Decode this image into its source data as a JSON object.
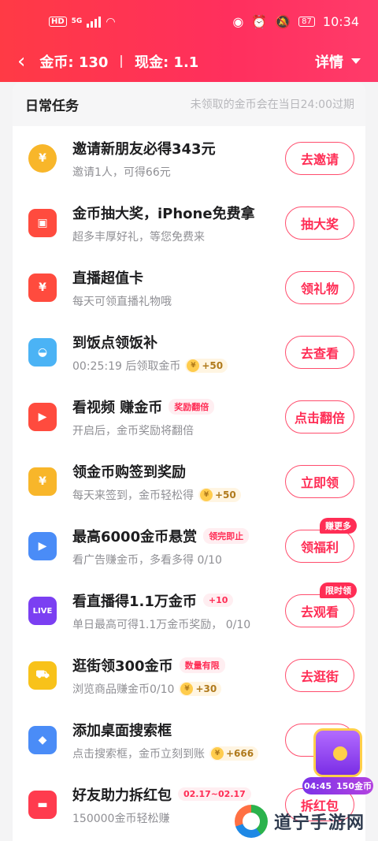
{
  "status_bar": {
    "hd": "HD",
    "network": "5G",
    "battery": "87",
    "time": "10:34"
  },
  "header": {
    "coins": "金币: 130",
    "cash": "现金: 1.1",
    "detail": "详情"
  },
  "card": {
    "title": "日常任务",
    "note": "未领取的金币会在当日24:00过期"
  },
  "tasks": [
    {
      "icon": "gold-coin-icon",
      "color": "#f8b62a",
      "title": "邀请新朋友必得343元",
      "tag": "",
      "sub": "邀请1人，可得66元",
      "reward": "",
      "button": "去邀请",
      "badge": ""
    },
    {
      "icon": "gift-box-icon",
      "color": "#ff4b3e",
      "title": "金币抽大奖，iPhone免费拿",
      "tag": "",
      "sub": "超多丰厚好礼，等您免费来",
      "reward": "",
      "button": "抽大奖",
      "badge": ""
    },
    {
      "icon": "live-gift-card-icon",
      "color": "#ff4b3e",
      "title": "直播超值卡",
      "tag": "",
      "sub": "每天可领直播礼物哦",
      "reward": "",
      "button": "领礼物",
      "badge": ""
    },
    {
      "icon": "rice-bowl-icon",
      "color": "#4bb3f5",
      "title": "到饭点领饭补",
      "tag": "",
      "sub": "00:25:19 后领取金币",
      "reward": "+50",
      "button": "去查看",
      "badge": ""
    },
    {
      "icon": "video-play-icon",
      "color": "#ff4b3e",
      "title": "看视频 赚金币",
      "tag": "奖励翻倍",
      "sub": "开启后，金币奖励将翻倍",
      "reward": "",
      "button": "点击翻倍",
      "badge": ""
    },
    {
      "icon": "money-bag-icon",
      "color": "#f8b62a",
      "title": "领金币购签到奖励",
      "tag": "",
      "sub": "每天来签到，金币轻松得",
      "reward": "+50",
      "button": "立即领",
      "badge": ""
    },
    {
      "icon": "ad-video-icon",
      "color": "#4a8cf7",
      "title": "最高6000金币悬赏",
      "tag": "领完即止",
      "sub": "看广告赚金币，多看多得 0/10",
      "reward": "",
      "button": "领福利",
      "badge": "赚更多"
    },
    {
      "icon": "live-tv-icon",
      "color": "#7b3ff2",
      "title": "看直播得1.1万金币",
      "tag": "+10",
      "sub": "单日最高可得1.1万金币奖励，  0/10",
      "reward": "",
      "button": "去观看",
      "badge": "限时领"
    },
    {
      "icon": "shopping-cart-icon",
      "color": "#f8c21a",
      "title": "逛街领300金币",
      "tag": "数量有限",
      "sub": "浏览商品赚金币0/10",
      "reward": "+30",
      "button": "去逛街",
      "badge": ""
    },
    {
      "icon": "desktop-search-widget-icon",
      "color": "#4a8cf7",
      "title": "添加桌面搜索框",
      "tag": "",
      "sub": "点击搜索框，金币立刻到账",
      "reward": "+666",
      "button": "去",
      "badge": ""
    },
    {
      "icon": "red-packet-icon",
      "color": "#ff3b4e",
      "title": "好友助力拆红包",
      "tag": "02.17~02.17",
      "sub": "150000金币轻松赚",
      "reward": "",
      "button": "拆红包",
      "badge": ""
    }
  ],
  "float_widget": {
    "timer": "04:45",
    "coins": "150金币"
  },
  "watermark": {
    "text": "道宁手游网"
  }
}
